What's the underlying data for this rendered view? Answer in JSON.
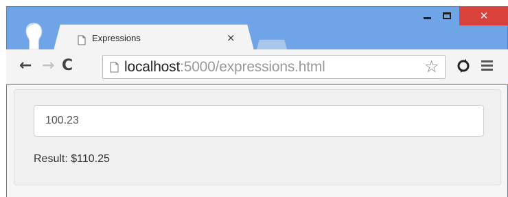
{
  "browser": {
    "tab": {
      "title": "Expressions",
      "close_glyph": "×"
    },
    "window_controls": {
      "close_glyph": "✕"
    },
    "toolbar": {
      "back_glyph": "←",
      "forward_glyph": "→",
      "reload_glyph": "C",
      "url_host": "localhost",
      "url_rest": ":5000/expressions.html",
      "star_glyph": "☆"
    },
    "icons": [
      "avatar-icon",
      "page-icon",
      "back-arrow-icon",
      "forward-arrow-icon",
      "reload-icon",
      "bookmark-star-icon",
      "extension-icon",
      "menu-icon"
    ]
  },
  "page": {
    "input_value": "100.23",
    "result_text": "Result: $110.25"
  },
  "colors": {
    "frame": "#6fa4e6",
    "close_button": "#d9423b",
    "tab_background": "#f4f4f4"
  }
}
